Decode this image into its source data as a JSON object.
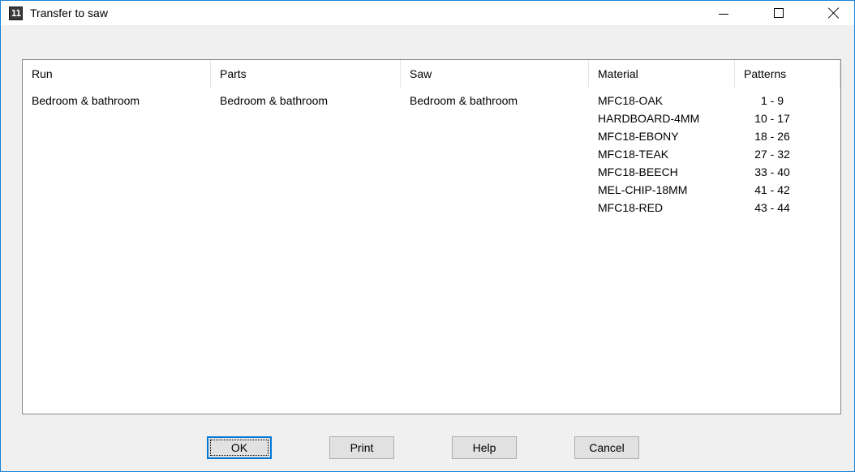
{
  "window": {
    "title": "Transfer to saw",
    "icon": "app-icon",
    "icon_glyph": "11",
    "controls": [
      "minimize-icon",
      "maximize-icon",
      "close-icon"
    ]
  },
  "list": {
    "columns": [
      "Run",
      "Parts",
      "Saw",
      "Material",
      "Patterns"
    ],
    "rows": [
      {
        "run": "Bedroom & bathroom",
        "parts": "Bedroom & bathroom",
        "saw": "Bedroom & bathroom",
        "material": "MFC18-OAK",
        "patterns": "1 - 9"
      },
      {
        "run": "",
        "parts": "",
        "saw": "",
        "material": "HARDBOARD-4MM",
        "patterns": "10 - 17"
      },
      {
        "run": "",
        "parts": "",
        "saw": "",
        "material": "MFC18-EBONY",
        "patterns": "18 - 26"
      },
      {
        "run": "",
        "parts": "",
        "saw": "",
        "material": "MFC18-TEAK",
        "patterns": "27 - 32"
      },
      {
        "run": "",
        "parts": "",
        "saw": "",
        "material": "MFC18-BEECH",
        "patterns": "33 - 40"
      },
      {
        "run": "",
        "parts": "",
        "saw": "",
        "material": "MEL-CHIP-18MM",
        "patterns": "41 - 42"
      },
      {
        "run": "",
        "parts": "",
        "saw": "",
        "material": "MFC18-RED",
        "patterns": "43 - 44"
      }
    ]
  },
  "buttons": {
    "ok": "OK",
    "print": "Print",
    "help": "Help",
    "cancel": "Cancel"
  },
  "colors": {
    "window_border": "#1883d7",
    "dialog_bg": "#f0f0f0",
    "default_button_border": "#0078d7"
  }
}
